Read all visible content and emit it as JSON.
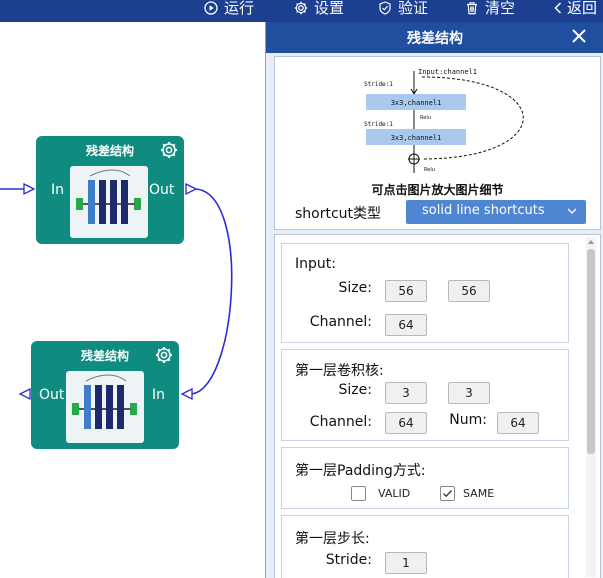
{
  "toolbar": {
    "run": "运行",
    "settings": "设置",
    "verify": "验证",
    "clear": "清空",
    "back": "返回"
  },
  "canvas": {
    "nodes": [
      {
        "title": "残差结构",
        "input_label": "In",
        "output_label": "Out"
      },
      {
        "title": "残差结构",
        "input_label": "In",
        "output_label": "Out"
      }
    ]
  },
  "panel": {
    "title": "残差结构",
    "preview": {
      "diagram_labels": {
        "input": "Input:channel1",
        "stride_1": "Stride:1",
        "conv_1": "3x3,channel1",
        "relu_1": "Relu",
        "stride_2": "Stride:1",
        "conv_2": "3x3,channel1",
        "relu_2": "Relu"
      },
      "hint": "可点击图片放大图片细节"
    },
    "shortcut": {
      "label": "shortcut类型",
      "value": "solid line shortcuts"
    },
    "input_section": {
      "title": "Input:",
      "size_label": "Size:",
      "size_values": [
        "56",
        "56"
      ],
      "channel_label": "Channel:",
      "channel_value": "64"
    },
    "conv1_section": {
      "title": "第一层卷积核:",
      "size_label": "Size:",
      "size_values": [
        "3",
        "3"
      ],
      "channel_label": "Channel:",
      "channel_value": "64",
      "num_label": "Num:",
      "num_value": "64"
    },
    "padding_section": {
      "title": "第一层Padding方式:",
      "options": [
        {
          "label": "VALID",
          "checked": false
        },
        {
          "label": "SAME",
          "checked": true
        }
      ]
    },
    "stride_section": {
      "title": "第一层步长:",
      "stride_label": "Stride:",
      "stride_value": "1"
    }
  },
  "colors": {
    "toolbar": "#1d3f8f",
    "node": "#0f8b80",
    "panel_header": "#1f4f9e",
    "select": "#4f86d4",
    "wire": "#2b2bd6"
  }
}
